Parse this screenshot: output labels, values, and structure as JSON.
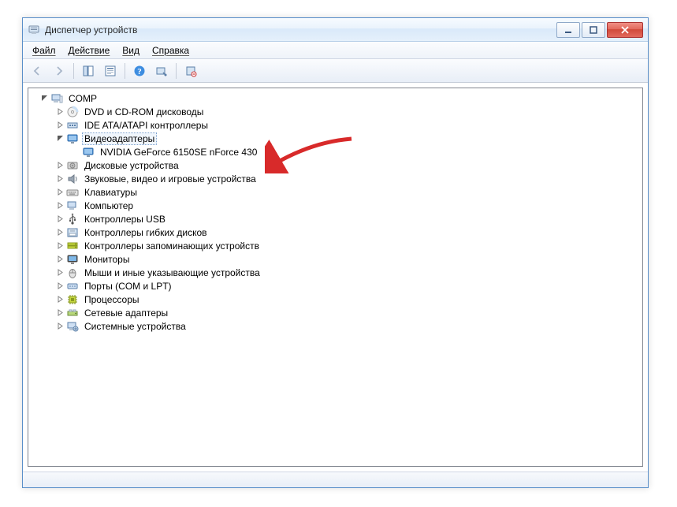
{
  "window": {
    "title": "Диспетчер устройств"
  },
  "menu": {
    "file": "Файл",
    "action": "Действие",
    "view": "Вид",
    "help": "Справка"
  },
  "tree": {
    "root": "COMP",
    "categories": [
      {
        "label": "DVD и CD-ROM дисководы",
        "icon": "disc"
      },
      {
        "label": "IDE ATA/ATAPI контроллеры",
        "icon": "ide"
      },
      {
        "label": "Видеоадаптеры",
        "icon": "display",
        "expanded": true,
        "selected": true,
        "children": [
          {
            "label": "NVIDIA GeForce 6150SE nForce 430",
            "icon": "display"
          }
        ]
      },
      {
        "label": "Дисковые устройства",
        "icon": "disk"
      },
      {
        "label": "Звуковые, видео и игровые устройства",
        "icon": "sound"
      },
      {
        "label": "Клавиатуры",
        "icon": "keyboard"
      },
      {
        "label": "Компьютер",
        "icon": "computer"
      },
      {
        "label": "Контроллеры USB",
        "icon": "usb"
      },
      {
        "label": "Контроллеры гибких дисков",
        "icon": "floppyctrl"
      },
      {
        "label": "Контроллеры запоминающих устройств",
        "icon": "storage"
      },
      {
        "label": "Мониторы",
        "icon": "monitor"
      },
      {
        "label": "Мыши и иные указывающие устройства",
        "icon": "mouse"
      },
      {
        "label": "Порты (COM и LPT)",
        "icon": "ports"
      },
      {
        "label": "Процессоры",
        "icon": "cpu"
      },
      {
        "label": "Сетевые адаптеры",
        "icon": "network"
      },
      {
        "label": "Системные устройства",
        "icon": "system"
      }
    ]
  }
}
